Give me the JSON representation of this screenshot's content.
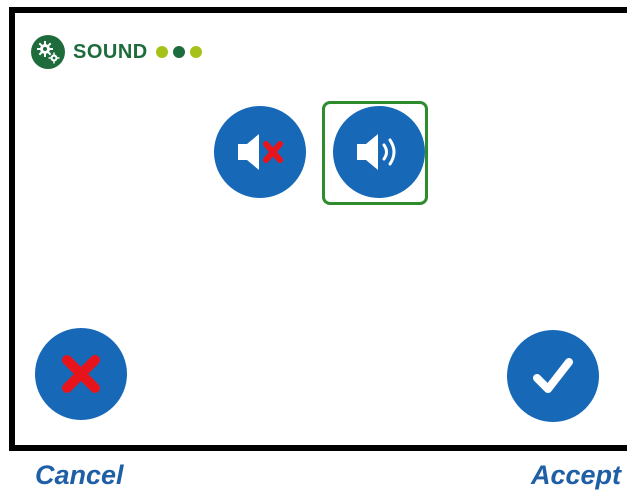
{
  "header": {
    "title": "SOUND",
    "icon": "gears-icon",
    "progress_dots": [
      "done",
      "current",
      "done"
    ]
  },
  "options": [
    {
      "name": "mute",
      "icon": "speaker-muted-icon",
      "selected": false
    },
    {
      "name": "sound-on",
      "icon": "speaker-on-icon",
      "selected": true
    }
  ],
  "actions": {
    "cancel_label": "Cancel",
    "accept_label": "Accept"
  },
  "colors": {
    "brand_green": "#1e6b3c",
    "light_green": "#a6c21a",
    "button_blue": "#1769b8",
    "selection_green": "#2e8b2e",
    "cancel_red": "#e8141c",
    "caption_blue": "#1f5fa5"
  }
}
